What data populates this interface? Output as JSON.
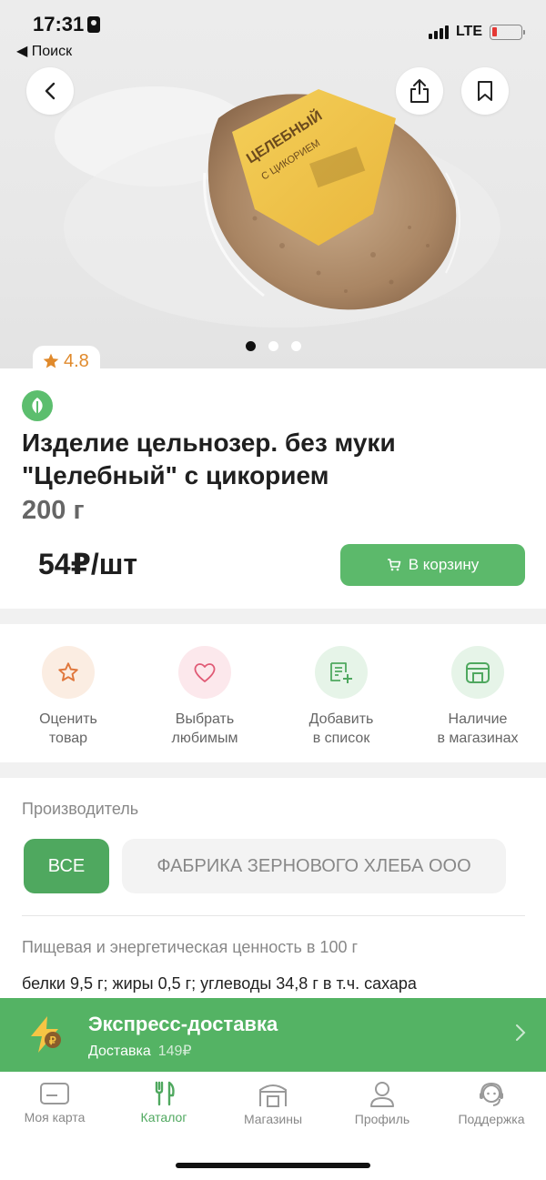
{
  "status_bar": {
    "time": "17:31",
    "back_label": "◀ Поиск",
    "network": "LTE"
  },
  "product": {
    "rating": "4.8",
    "title": "Изделие цельнозер. без муки \"Целебный\" с цикорием",
    "weight": "200 г",
    "price": "54₽/шт",
    "add_to_cart_label": "В корзину",
    "images_count": 3,
    "active_image_index": 0
  },
  "actions": [
    {
      "label": "Оценить\nтовар",
      "icon": "star-icon"
    },
    {
      "label": "Выбрать\nлюбимым",
      "icon": "heart-icon"
    },
    {
      "label": "Добавить\nв список",
      "icon": "add-to-list-icon"
    },
    {
      "label": "Наличие\nв магазинах",
      "icon": "store-icon"
    }
  ],
  "manufacturer": {
    "heading": "Производитель",
    "filter_all": "ВСЕ",
    "filter_maker": "ФАБРИКА ЗЕРНОВОГО ХЛЕБА ООО"
  },
  "nutrition": {
    "heading": "Пищевая и энергетическая ценность в 100 г",
    "text": "белки 9,5 г; жиры 0,5 г; углеводы 34,8 г в т.ч. сахара"
  },
  "delivery": {
    "title": "Экспресс-доставка",
    "label": "Доставка",
    "fee": "149₽"
  },
  "tabbar": [
    {
      "label": "Моя карта",
      "icon": "card-icon",
      "active": false
    },
    {
      "label": "Каталог",
      "icon": "fork-knife-icon",
      "active": true
    },
    {
      "label": "Магазины",
      "icon": "store-icon",
      "active": false
    },
    {
      "label": "Профиль",
      "icon": "profile-icon",
      "active": false
    },
    {
      "label": "Поддержка",
      "icon": "support-icon",
      "active": false
    }
  ],
  "colors": {
    "accent_green": "#54b364",
    "rating_orange": "#e08a2c"
  }
}
